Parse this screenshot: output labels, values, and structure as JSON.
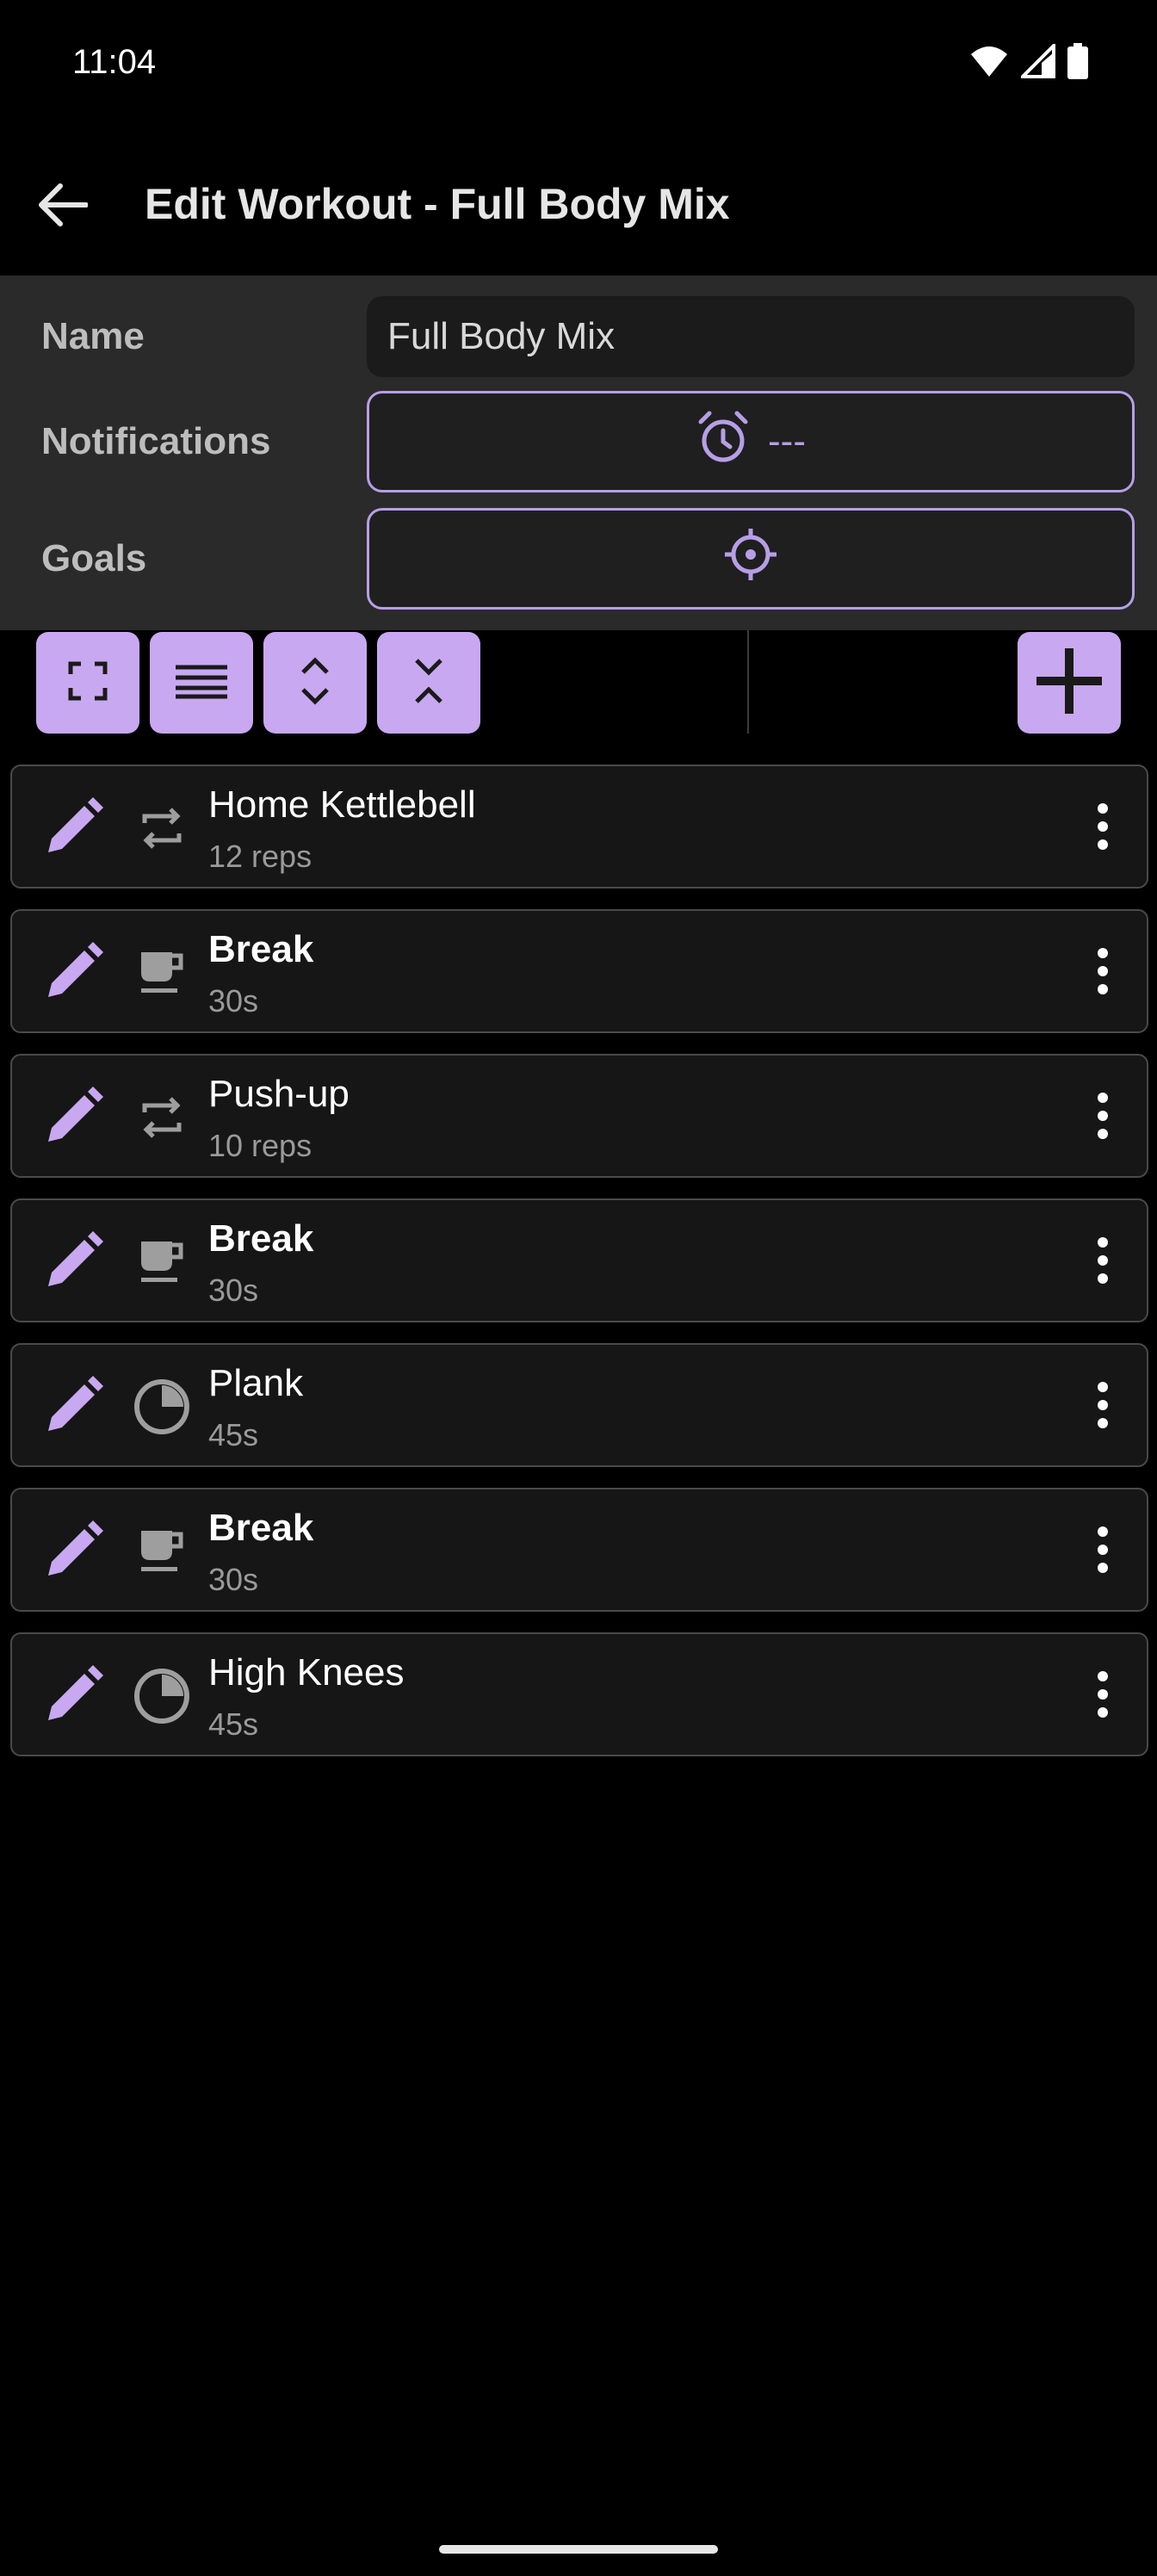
{
  "status_bar": {
    "time": "11:04"
  },
  "app_bar": {
    "title": "Edit Workout - Full Body Mix"
  },
  "form": {
    "name_label": "Name",
    "name_value": "Full Body Mix",
    "notifications_label": "Notifications",
    "notifications_value": "---",
    "goals_label": "Goals"
  },
  "colors": {
    "accent": "#c8a8f0",
    "accent_outline": "#b79ee6",
    "background": "#000000",
    "panel": "#2a2a2a"
  },
  "items": [
    {
      "title": "Home Kettlebell",
      "sub": "12 reps",
      "icon": "repeat-icon"
    },
    {
      "title": "Break",
      "sub": "30s",
      "icon": "coffee-cup-icon"
    },
    {
      "title": "Push-up",
      "sub": "10 reps",
      "icon": "repeat-icon"
    },
    {
      "title": "Break",
      "sub": "30s",
      "icon": "coffee-cup-icon"
    },
    {
      "title": "Plank",
      "sub": "45s",
      "icon": "timer-pie-icon"
    },
    {
      "title": "Break",
      "sub": "30s",
      "icon": "coffee-cup-icon"
    },
    {
      "title": "High Knees",
      "sub": "45s",
      "icon": "timer-pie-icon"
    }
  ]
}
